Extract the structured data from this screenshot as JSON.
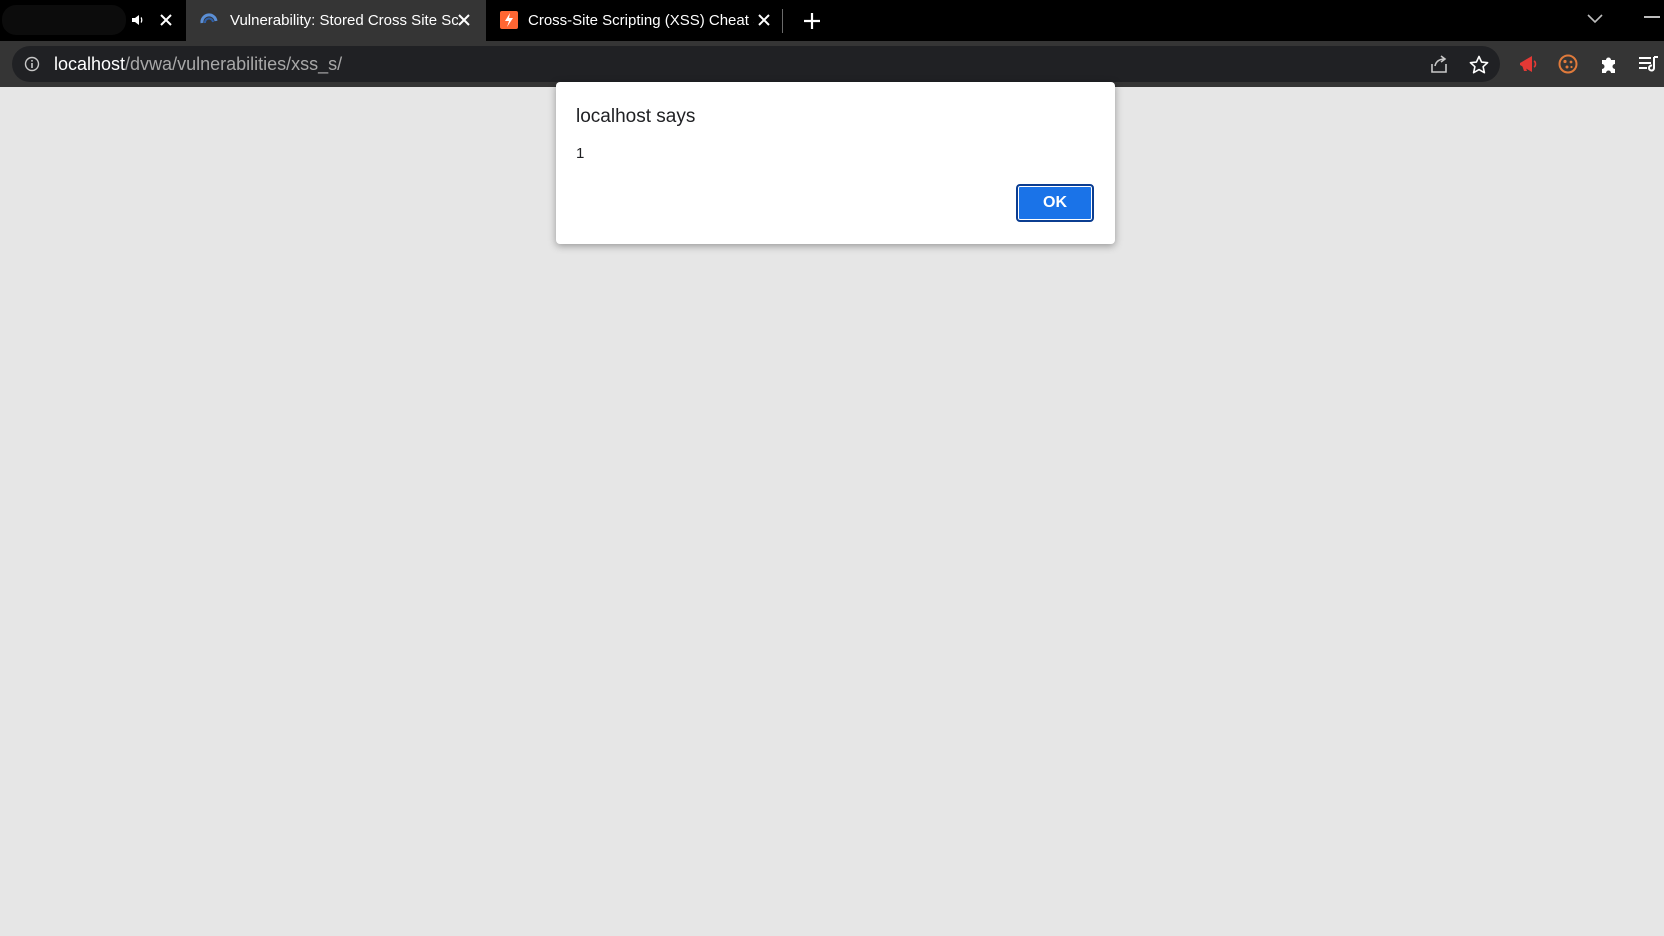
{
  "tabs": [
    {
      "title": "",
      "redacted": true,
      "audio_icon": "speaker-icon"
    },
    {
      "title": "Vulnerability: Stored Cross Site Sc",
      "active": true,
      "favicon": "dvwa-favicon-icon"
    },
    {
      "title": "Cross-Site Scripting (XSS) Cheat S",
      "active": false,
      "favicon": "portswigger-favicon-icon"
    }
  ],
  "address_bar": {
    "host": "localhost",
    "path": "/dvwa/vulnerabilities/xss_s/"
  },
  "toolbar_icons": [
    "share-icon",
    "bookmark-star-icon",
    "extension-megaphone-icon",
    "extension-cookie-icon",
    "extensions-puzzle-icon",
    "reading-list-icon"
  ],
  "dialog": {
    "title": "localhost says",
    "message": "1",
    "ok_label": "OK"
  },
  "colors": {
    "tabstrip_bg": "#000000",
    "toolbar_bg": "#353535",
    "omnibox_bg": "#202124",
    "page_bg": "#e6e6e6",
    "ok_button_bg": "#1a73e8"
  }
}
